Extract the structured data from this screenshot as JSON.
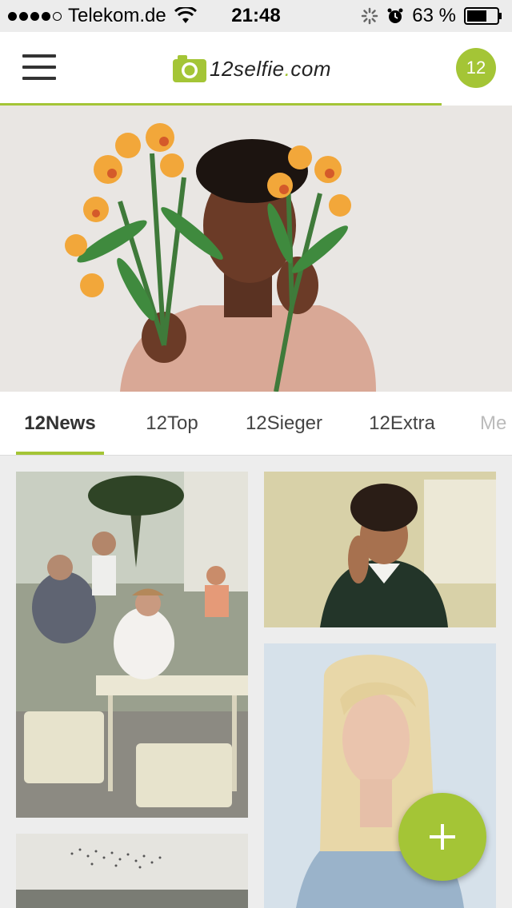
{
  "status_bar": {
    "carrier": "Telekom.de",
    "time": "21:48",
    "battery": "63 %",
    "signal_dots_filled": 4,
    "icons": [
      "wifi-icon",
      "spinner-icon",
      "alarm-icon",
      "battery-icon"
    ]
  },
  "header": {
    "logo": {
      "part1": "12selfie",
      "dot": ".",
      "part2": "com"
    },
    "badge_count": "12",
    "icons": [
      "menu-icon",
      "camera-logo-icon"
    ]
  },
  "hero": {
    "description_icon": "hero-photo"
  },
  "tabs": [
    {
      "label": "12News",
      "active": true
    },
    {
      "label": "12Top",
      "active": false
    },
    {
      "label": "12Sieger",
      "active": false
    },
    {
      "label": "12Extra",
      "active": false
    },
    {
      "label": "Me",
      "active": false
    }
  ],
  "grid": {
    "items": [
      {
        "name": "photo-cafe"
      },
      {
        "name": "photo-boy"
      },
      {
        "name": "photo-blonde-woman"
      },
      {
        "name": "photo-birds-sky"
      }
    ]
  },
  "fab": {
    "icon": "plus-icon"
  },
  "colors": {
    "accent": "#a4c536",
    "status_bar_bg": "#ececec",
    "background": "#ededed"
  }
}
